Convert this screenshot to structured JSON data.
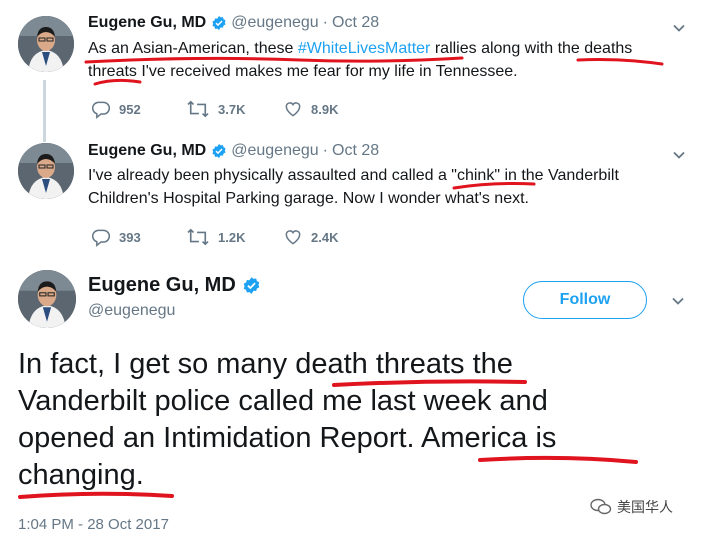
{
  "tweets": [
    {
      "name": "Eugene Gu, MD",
      "handle": "@eugenegu",
      "sep": "·",
      "date": "Oct 28",
      "text_1": "As an Asian-American, these ",
      "hashtag": "#WhiteLivesMatter",
      "text_2": " rallies along with the deaths",
      "text_3": "threats I've received makes me fear for my life in Tennessee.",
      "replies": "952",
      "retweets": "3.7K",
      "likes": "8.9K"
    },
    {
      "name": "Eugene Gu, MD",
      "handle": "@eugenegu",
      "sep": "·",
      "date": "Oct 28",
      "line_1": "I've already been physically assaulted and called a \"chink\" in the Vanderbilt",
      "line_2": "Children's Hospital Parking garage. Now I wonder what's next.",
      "replies": "393",
      "retweets": "1.2K",
      "likes": "2.4K"
    }
  ],
  "main": {
    "name": "Eugene Gu, MD",
    "handle": "@eugenegu",
    "follow_label": "Follow",
    "line_1": "In fact, I get so many death threats the",
    "line_2": "Vanderbilt police called me last week and",
    "line_3": "opened an Intimidation Report. America is",
    "line_4": "changing.",
    "timestamp": "1:04 PM - 28 Oct 2017"
  },
  "watermark": {
    "text": "美国华人"
  },
  "colors": {
    "link": "#1da1f2",
    "secondary": "#657786",
    "verified": "#1da1f2",
    "annotation_red": "#e0141e"
  }
}
